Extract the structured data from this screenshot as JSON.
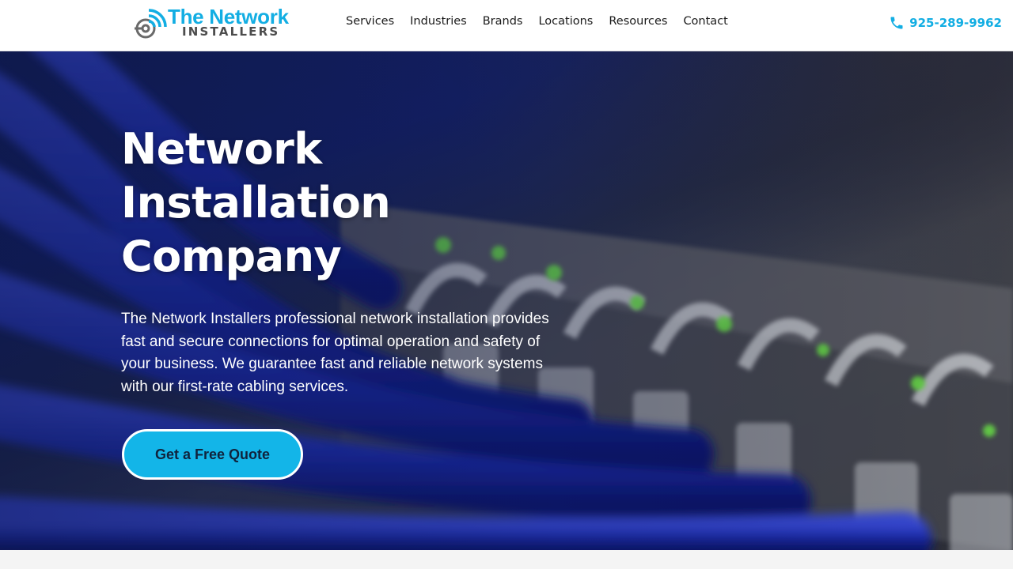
{
  "header": {
    "logo": {
      "line1": "The Network",
      "line2": "INSTALLERS"
    },
    "nav": [
      "Services",
      "Industries",
      "Brands",
      "Locations",
      "Resources",
      "Contact"
    ],
    "phone": "925-289-9962",
    "icons": {
      "logo": "wifi-target-logo-icon",
      "phone": "phone-icon"
    }
  },
  "hero": {
    "title": "Network Installation Company",
    "description": "The Network Installers professional network installation provides fast and secure connections for optimal operation and safety of your business. We guarantee fast and reliable network systems with our first-rate cabling services.",
    "cta_label": "Get a Free Quote",
    "background": "network-switch-with-blue-cables-photo"
  },
  "colors": {
    "accent": "#13aee3",
    "nav_text": "#1a1a1a",
    "logo_gray": "#4d4d4d",
    "cta_bg": "#13b5e8",
    "hero_text": "#ffffff"
  }
}
